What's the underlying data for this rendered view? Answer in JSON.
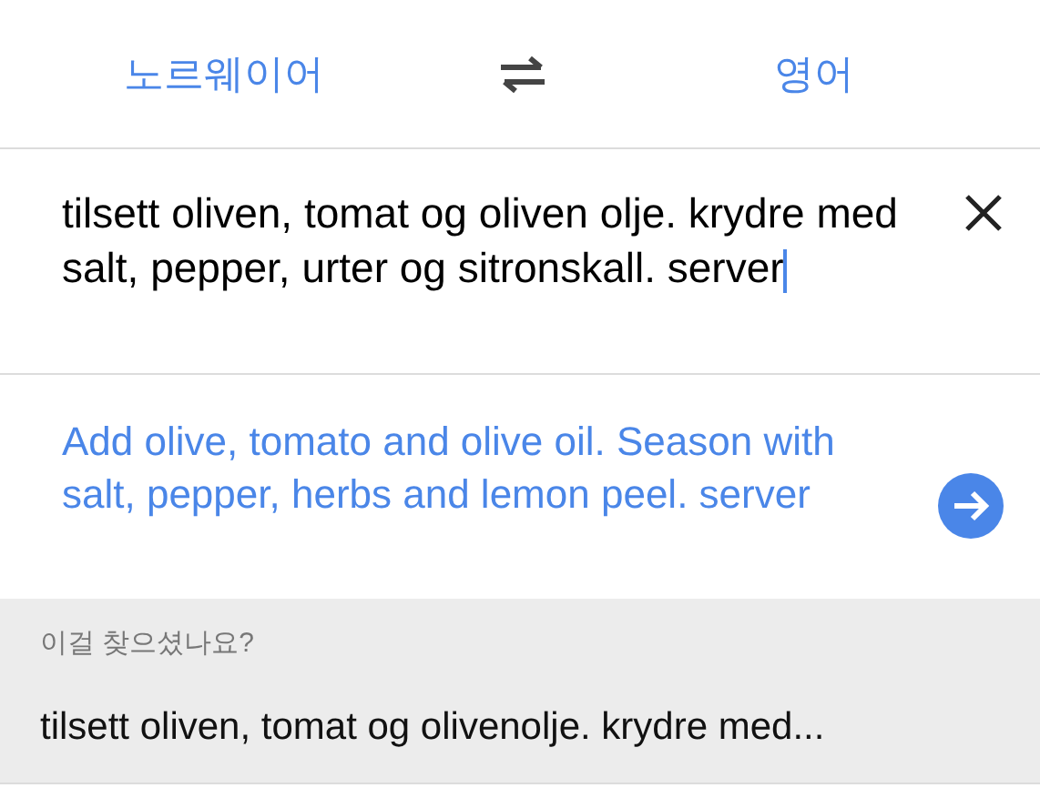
{
  "languages": {
    "source": "노르웨이어",
    "target": "영어"
  },
  "input": {
    "value": "tilsett oliven, tomat og oliven olje. krydre med salt, pepper, urter og sitronskall. server"
  },
  "translation": {
    "text": "Add olive, tomato and olive oil.  Season with salt, pepper, herbs and lemon peel. server"
  },
  "suggestion": {
    "heading": "이걸 찾으셨나요?",
    "text": "tilsett oliven, tomat og olivenolje. krydre med..."
  }
}
